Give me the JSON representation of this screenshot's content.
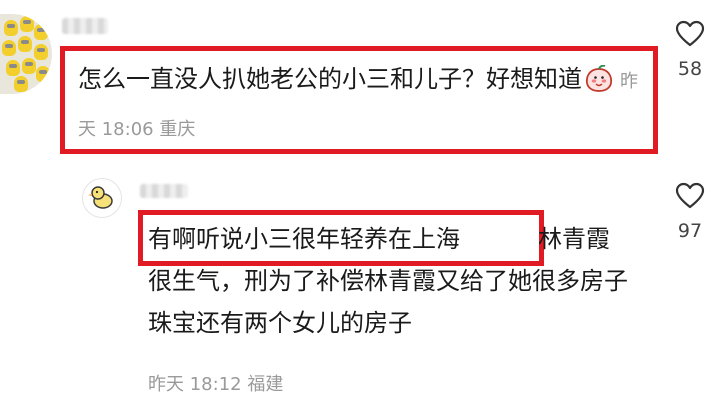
{
  "comment": {
    "text": "怎么一直没人扒她老公的小三和儿子？好想知道",
    "time": "昨天 18:06",
    "location": "重庆",
    "likes": "58",
    "emoji_icon": "peach-emoji-icon"
  },
  "reply": {
    "text_highlight": "有啊听说小三很年轻养在上海",
    "text_rest": "林青霞很生气，刑为了补偿林青霞又给了她很多房子珠宝还有两个女儿的房子",
    "time": "昨天 18:12",
    "location": "福建",
    "likes": "97"
  },
  "colors": {
    "highlight_border": "#e01b24",
    "meta_text": "#9a9a9a"
  }
}
